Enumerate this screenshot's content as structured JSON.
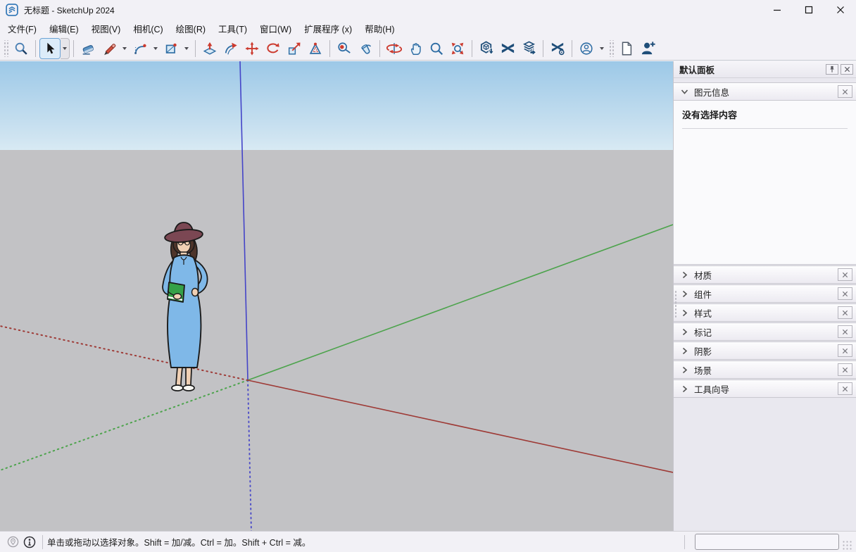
{
  "window": {
    "title": "无标题 - SketchUp 2024"
  },
  "menu": {
    "items": [
      {
        "label": "文件(F)"
      },
      {
        "label": "编辑(E)"
      },
      {
        "label": "视图(V)"
      },
      {
        "label": "相机(C)"
      },
      {
        "label": "绘图(R)"
      },
      {
        "label": "工具(T)"
      },
      {
        "label": "窗口(W)"
      },
      {
        "label": "扩展程序 (x)"
      },
      {
        "label": "帮助(H)"
      }
    ]
  },
  "toolbar": {
    "active_tool": "select",
    "tools": [
      "search",
      "select",
      "eraser",
      "line",
      "arc",
      "rectangle",
      "push-pull",
      "follow-me",
      "move",
      "rotate",
      "scale",
      "offset",
      "tape-measure",
      "paint-bucket",
      "orbit",
      "pan",
      "zoom",
      "zoom-extents",
      "3d-warehouse",
      "extension-warehouse",
      "share-model",
      "extension-manager",
      "account",
      "new-file",
      "sign-in"
    ]
  },
  "panel": {
    "title": "默认面板",
    "entity_info": {
      "label": "图元信息",
      "empty_text": "没有选择内容"
    },
    "sections": [
      {
        "label": "材质"
      },
      {
        "label": "组件"
      },
      {
        "label": "样式"
      },
      {
        "label": "标记"
      },
      {
        "label": "阴影"
      },
      {
        "label": "场景"
      },
      {
        "label": "工具向导"
      }
    ]
  },
  "statusbar": {
    "hint": "单击或拖动以选择对象。Shift = 加/减。Ctrl = 加。Shift + Ctrl = 减。",
    "measurement_value": ""
  },
  "viewport": {
    "colors": {
      "sky_top": "#9cc8e7",
      "sky_horizon": "#d8eaf4",
      "ground": "#c2c2c5",
      "axis_red": "#9e3a36",
      "axis_green": "#4ca34c",
      "axis_blue": "#4444c8"
    }
  }
}
